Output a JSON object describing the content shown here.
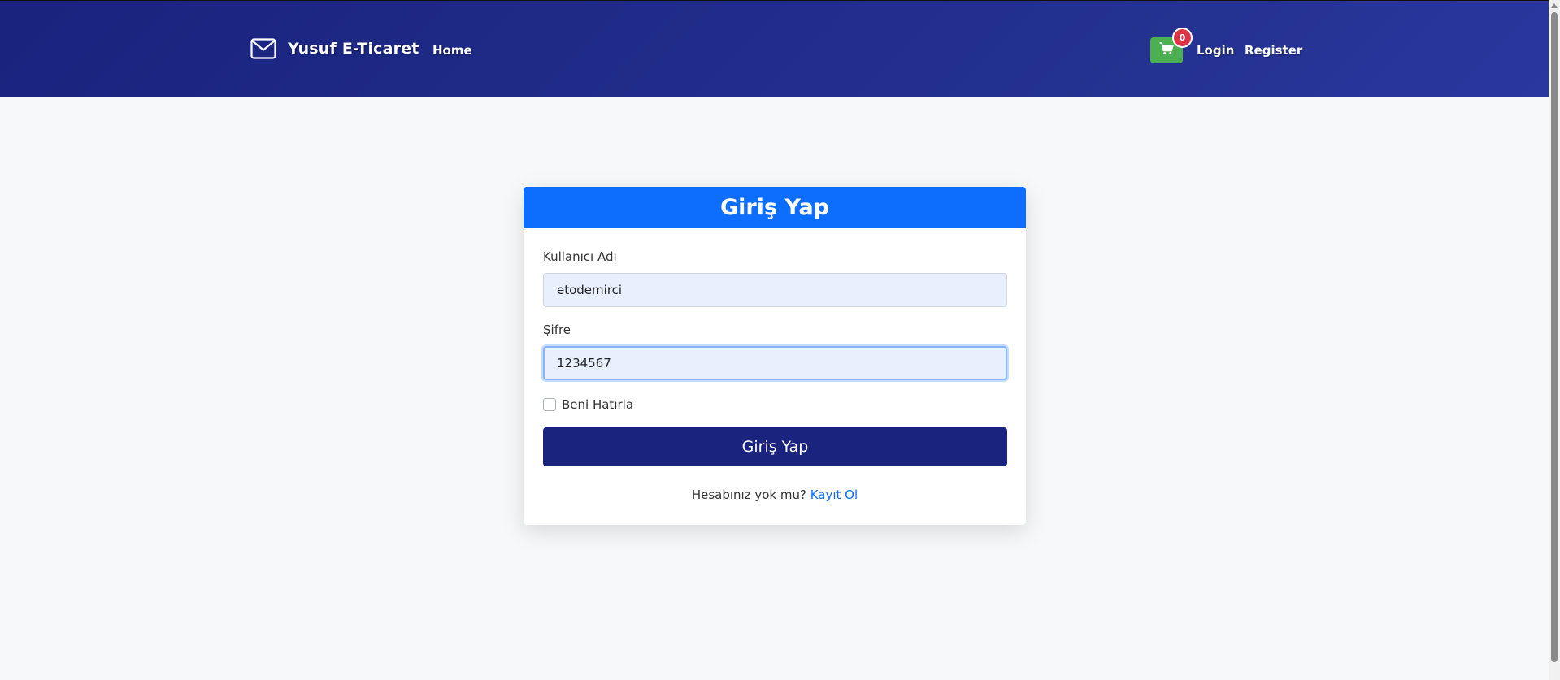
{
  "navbar": {
    "brand_icon": "envelope-icon",
    "brand_text": "Yusuf E-Ticaret",
    "home_label": "Home",
    "cart_icon": "shopping-cart-icon",
    "cart_count": "0",
    "login_label": "Login",
    "register_label": "Register"
  },
  "login_card": {
    "title": "Giriş Yap",
    "username_label": "Kullanıcı Adı",
    "username_value": "etodemirci",
    "password_label": "Şifre",
    "password_value": "1234567",
    "remember_label": "Beni Hatırla",
    "remember_checked": false,
    "submit_label": "Giriş Yap",
    "no_account_text": "Hesabınız yok mu?",
    "signup_link": "Kayıt Ol"
  },
  "colors": {
    "navbar_bg": "#1a237e",
    "card_header": "#0d6efd",
    "submit_button": "#1a237e",
    "cart_button": "#4caf50",
    "badge": "#dc3545",
    "link": "#0d6efd",
    "page_bg": "#f7f8fa"
  }
}
